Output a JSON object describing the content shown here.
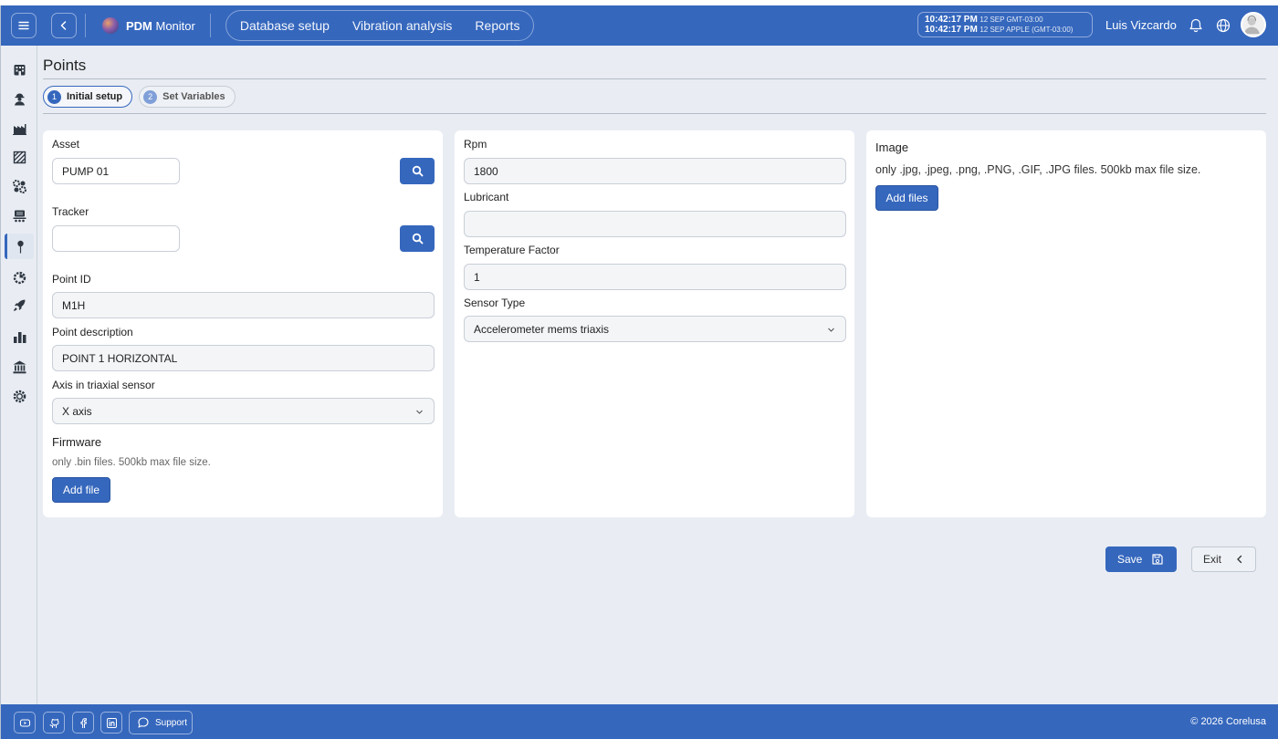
{
  "app": {
    "brand_bold": "PDM",
    "brand_rest": " Monitor"
  },
  "nav": [
    "Database setup",
    "Vibration analysis",
    "Reports"
  ],
  "clock": {
    "line1_time": "10:42:17 PM",
    "line1_info": "12 SEP  GMT-03:00",
    "line2_time": "10:42:17 PM",
    "line2_info": "12 SEP  APPLE (GMT-03:00)"
  },
  "user": {
    "name": "Luis Vizcardo"
  },
  "page": {
    "title": "Points"
  },
  "steps": [
    {
      "num": "1",
      "label": "Initial setup",
      "active": true
    },
    {
      "num": "2",
      "label": "Set Variables",
      "active": false
    }
  ],
  "form": {
    "asset_label": "Asset",
    "asset_value": "PUMP 01",
    "tracker_label": "Tracker",
    "tracker_value": "",
    "point_id_label": "Point ID",
    "point_id_value": "M1H",
    "point_desc_label": "Point description",
    "point_desc_value": "POINT 1 HORIZONTAL",
    "axis_label": "Axis in triaxial sensor",
    "axis_value": "X axis",
    "firmware_title": "Firmware",
    "firmware_hint": "only .bin files. 500kb max file size.",
    "firmware_button": "Add file",
    "rpm_label": "Rpm",
    "rpm_value": "1800",
    "lubricant_label": "Lubricant",
    "lubricant_value": "",
    "temp_label": "Temperature Factor",
    "temp_value": "1",
    "sensor_label": "Sensor Type",
    "sensor_value": "Accelerometer mems triaxis",
    "image_title": "Image",
    "image_hint": "only .jpg, .jpeg, .png, .PNG, .GIF, .JPG files. 500kb max file size.",
    "image_button": "Add files"
  },
  "actions": {
    "save": "Save",
    "exit": "Exit"
  },
  "footer": {
    "support": "Support",
    "copyright": "© 2026 Corelusa"
  },
  "colors": {
    "primary": "#3567bd",
    "background": "#e9edf3"
  }
}
